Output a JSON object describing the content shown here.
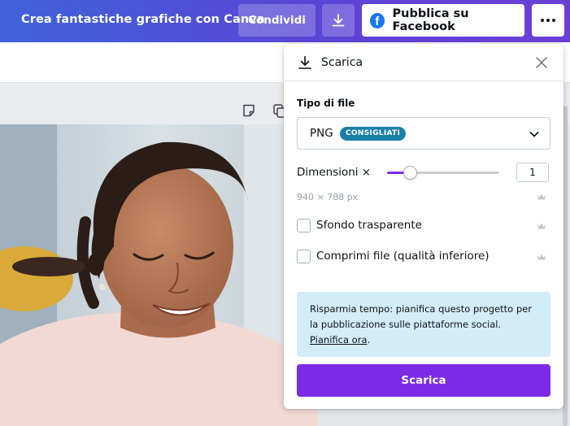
{
  "topbar": {
    "title": "Crea fantastiche grafiche con Canva",
    "share_label": "Condividi",
    "download_icon": "download-icon",
    "facebook_label": "Pubblica su Facebook",
    "facebook_glyph": "f",
    "more_icon": "more-horizontal-icon"
  },
  "canvas": {
    "icons": [
      "note-icon",
      "copy-icon"
    ]
  },
  "panel": {
    "title": "Scarica",
    "header_icon": "download-icon",
    "close_icon": "close-icon",
    "file_type_label": "Tipo di file",
    "file_type_value": "PNG",
    "file_type_badge": "CONSIGLIATI",
    "dimensions_label": "Dimensioni ×",
    "dimensions_value": "1",
    "dimensions_slider_fraction": 0.2,
    "size_px": "940 × 788 px",
    "transparent_bg_label": "Sfondo trasparente",
    "transparent_bg_checked": false,
    "compress_label": "Comprimi file (qualità inferiore)",
    "compress_checked": false,
    "info_text": "Risparmia tempo: pianifica questo progetto per la pubblicazione sulle piattaforme social. ",
    "info_link": "Pianifica ora",
    "info_tail": ".",
    "download_button": "Scarica",
    "premium_icon": "crown-icon"
  },
  "colors": {
    "accent": "#7d2ae8",
    "badge": "#1a7fa8",
    "info_bg": "#d3edf8",
    "facebook": "#1877f2"
  }
}
